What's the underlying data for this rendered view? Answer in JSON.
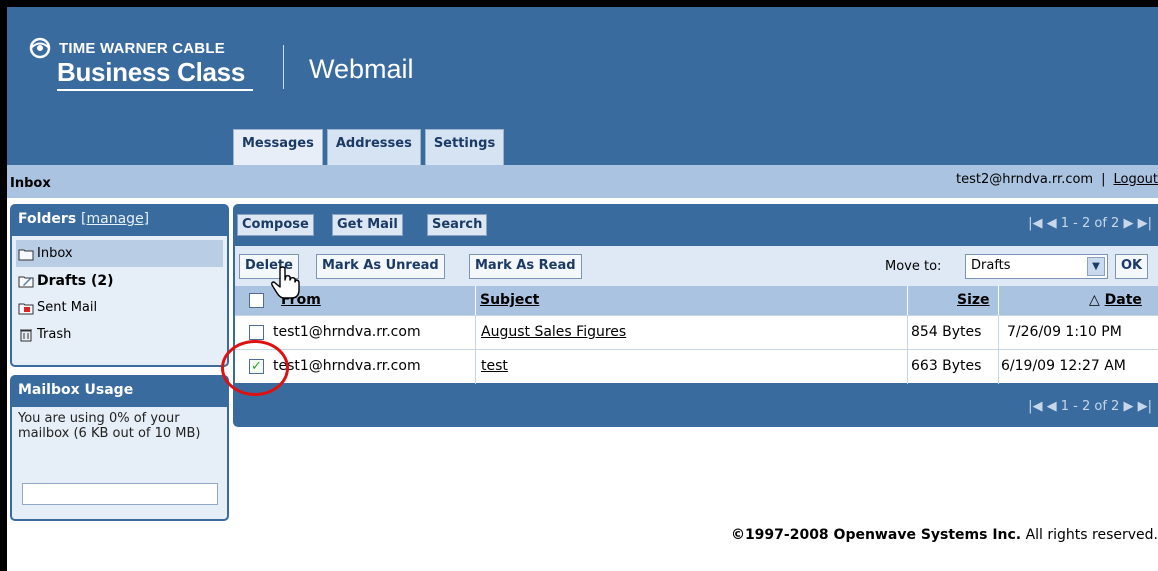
{
  "header": {
    "brand_line1": "TIME WARNER CABLE",
    "brand_line2": "Business Class",
    "app_name": "Webmail",
    "tabs": [
      {
        "label": "Messages",
        "active": true
      },
      {
        "label": "Addresses",
        "active": false
      },
      {
        "label": "Settings",
        "active": false
      }
    ]
  },
  "inbox_bar": {
    "title": "Inbox",
    "user_email": "test2@hrndva.rr.com",
    "separator": "|",
    "logout_label": "Logout"
  },
  "folders": {
    "title": "Folders",
    "manage_label": "[manage]",
    "items": [
      {
        "label": "Inbox",
        "icon": "folder-icon",
        "selected": true
      },
      {
        "label": "Drafts (2)",
        "icon": "drafts-icon",
        "bold": true
      },
      {
        "label": "Sent Mail",
        "icon": "sent-mail-icon"
      },
      {
        "label": "Trash",
        "icon": "trash-icon"
      }
    ]
  },
  "mailbox_usage": {
    "title": "Mailbox Usage",
    "text": "You are using 0% of your mailbox (6 KB out of 10 MB)",
    "percent": 0
  },
  "toolbar": {
    "compose_label": "Compose",
    "get_mail_label": "Get Mail",
    "search_label": "Search",
    "pager_text": "1 - 2 of 2"
  },
  "actions": {
    "delete_label": "Delete",
    "mark_unread_label": "Mark As Unread",
    "mark_read_label": "Mark As Read",
    "move_to_label": "Move to:",
    "move_to_value": "Drafts",
    "ok_label": "OK"
  },
  "table": {
    "columns": {
      "from": "From",
      "subject": "Subject",
      "size": "Size",
      "date": "Date"
    },
    "sort_indicator": "△",
    "rows": [
      {
        "from": "test1@hrndva.rr.com",
        "subject": "August Sales Figures",
        "size": "854 Bytes",
        "date": "7/26/09 1:10 PM",
        "checked": false
      },
      {
        "from": "test1@hrndva.rr.com",
        "subject": "test",
        "size": "663 Bytes",
        "date": "6/19/09 12:27 AM",
        "checked": true
      }
    ]
  },
  "footer": {
    "copyright_bold": "©1997-2008 Openwave Systems Inc.",
    "copyright_rest": " All rights reserved."
  },
  "colors": {
    "brand_blue": "#3a6b9f",
    "light_blue": "#aac3e0",
    "highlight_red": "#d11111"
  }
}
